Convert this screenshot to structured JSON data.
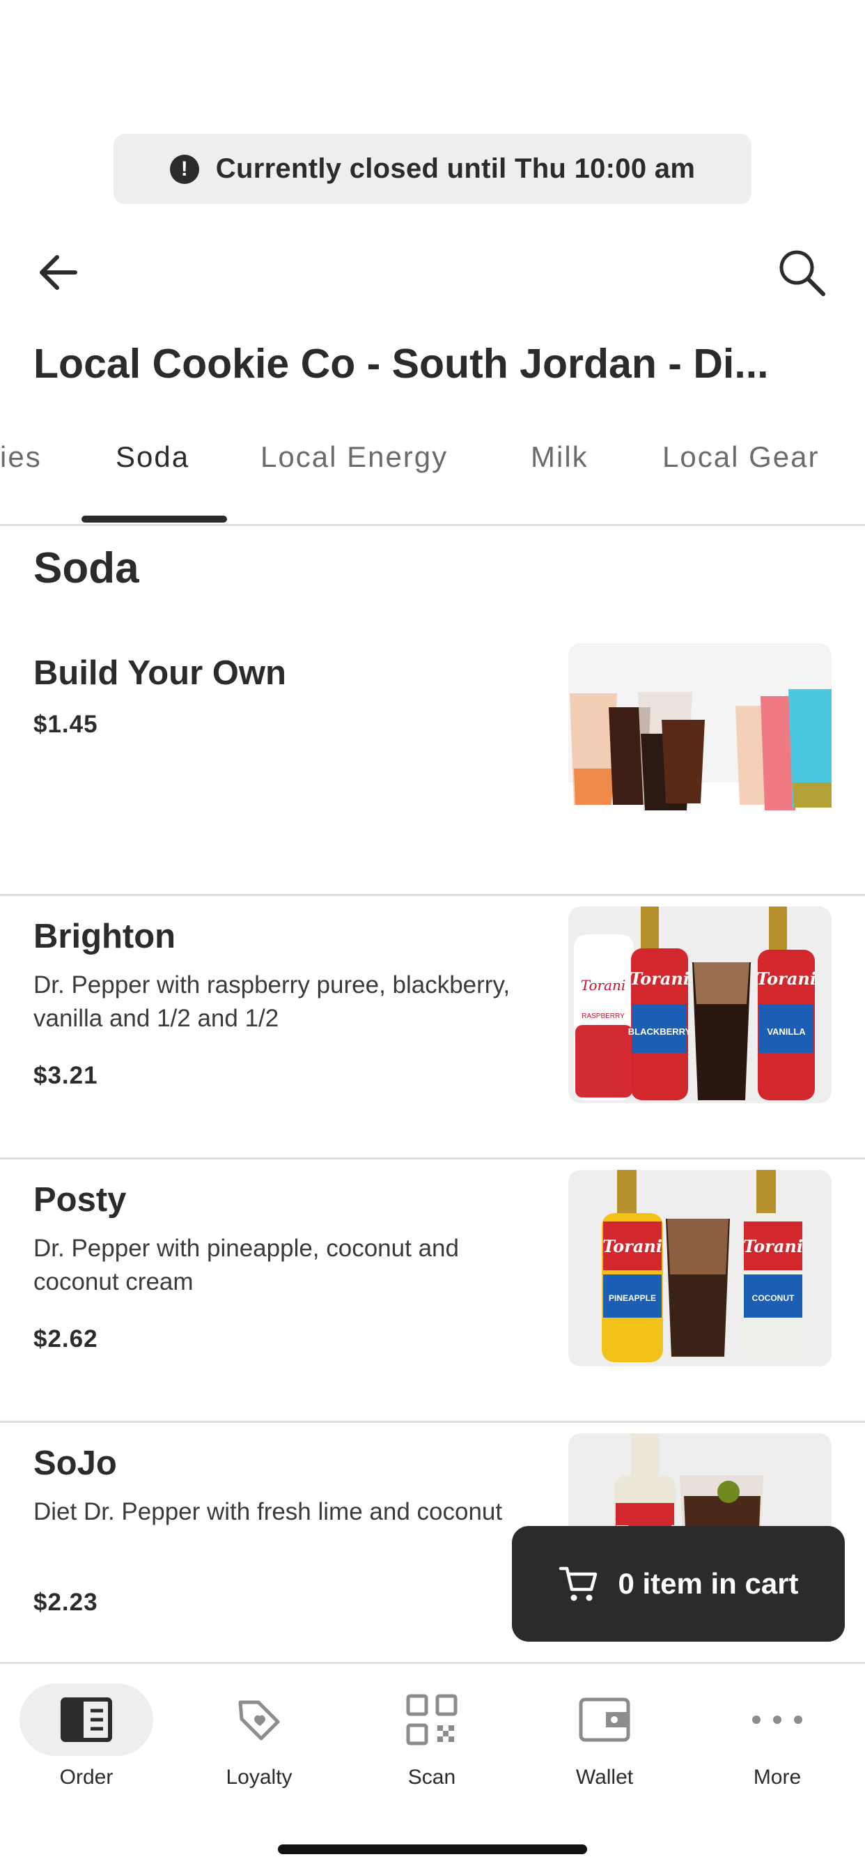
{
  "status_banner": {
    "icon": "alert-circle-icon",
    "text": "Currently closed until Thu 10:00 am"
  },
  "header": {
    "back_icon": "arrow-left-icon",
    "search_icon": "search-icon"
  },
  "store_title": "Local Cookie Co - South Jordan - Di...",
  "tabs": [
    {
      "label": "ies",
      "active": false
    },
    {
      "label": "Soda",
      "active": true
    },
    {
      "label": "Local Energy",
      "active": false
    },
    {
      "label": "Milk",
      "active": false
    },
    {
      "label": "Local Gear",
      "active": false
    }
  ],
  "section_title": "Soda",
  "items": [
    {
      "name": "Build Your Own",
      "description": "",
      "price": "$1.45"
    },
    {
      "name": "Brighton",
      "description": "Dr. Pepper with raspberry puree, blackberry, vanilla and 1/2 and 1/2",
      "price": "$3.21"
    },
    {
      "name": "Posty",
      "description": "Dr. Pepper with pineapple, coconut and coconut cream",
      "price": "$2.62"
    },
    {
      "name": "SoJo",
      "description": "Diet Dr. Pepper with fresh lime and coconut",
      "price": "$2.23"
    }
  ],
  "bottle_labels": {
    "brand": "Torani",
    "raspberry": "RASPBERRY",
    "blackberry": "BLACKBERRY",
    "vanilla": "VANILLA",
    "pineapple": "PINEAPPLE",
    "coconut": "COCONUT"
  },
  "cart": {
    "label": "0 item in cart",
    "icon": "cart-icon"
  },
  "bottom_nav": [
    {
      "label": "Order",
      "icon": "order-menu-icon",
      "active": true
    },
    {
      "label": "Loyalty",
      "icon": "tag-heart-icon",
      "active": false
    },
    {
      "label": "Scan",
      "icon": "qr-code-icon",
      "active": false
    },
    {
      "label": "Wallet",
      "icon": "wallet-icon",
      "active": false
    },
    {
      "label": "More",
      "icon": "more-dots-icon",
      "active": false
    }
  ],
  "colors": {
    "primary": "#2b2b2b",
    "muted": "#6b6b6b",
    "banner_bg": "#eeeeee",
    "divider": "#dcdcdc"
  }
}
